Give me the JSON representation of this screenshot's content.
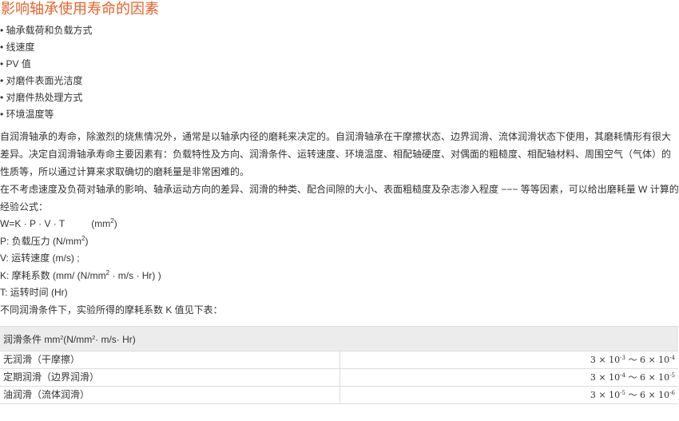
{
  "title": "影响轴承使用寿命的因素",
  "factors": [
    "轴承载荷和负载方式",
    "线速度",
    "PV 值",
    "对磨件表面光洁度",
    "对磨件热处理方式",
    "环境温度等"
  ],
  "paragraphs": [
    "自润滑轴承的寿命，除激烈的烧焦情况外，通常是以轴承内径的磨耗来决定的。自润滑轴承在干摩擦状态、边界润滑、流体润滑状态下使用，其磨耗情形有很大差异。决定自润滑轴承寿命主要因素有：负载特性及方向、润滑条件、运转速度、环境温度、相配轴硬度、对偶面的粗糙度、相配轴材料、周围空气（气体）的性质等，所以通过计算来求取确切的磨耗量是非常困难的。",
    "在不考虑速度及负荷对轴承的影响、轴承运动方向的差异、润滑的种类、配合间隙的大小、表面粗糙度及杂志渗入程度 −−− 等等因素，可以给出磨耗量 W 计算的经验公式："
  ],
  "formula": {
    "expr": "W=K · P · V · T",
    "unit_prefix": "(mm",
    "unit_exp": "2",
    "unit_suffix": ")"
  },
  "definitions": {
    "p_prefix": "P: 负载压力 (N/mm",
    "p_exp": "2",
    "p_suffix": ")",
    "v": "V: 运转速度 (m/s) ;",
    "k_prefix": "K: 摩耗系数 (mm/ (N/mm",
    "k_exp": "2",
    "k_suffix": " ·  m/s ·  Hr) )",
    "t": "T: 运转时间 (Hr)"
  },
  "table_intro": "不同润滑条件下，实验所得的摩耗系数 K 值见下表：",
  "table": {
    "header_prefix": "润滑条件 mm",
    "header_exp": "2",
    "header_mid": "(N/mm",
    "header_exp2": "2",
    "header_suffix": "· m/s· Hr)",
    "rows": [
      {
        "condition": "无润滑（干摩擦）",
        "lo_exp": "-3",
        "hi_exp": "-4"
      },
      {
        "condition": "定期润滑（边界润滑）",
        "lo_exp": "-4",
        "hi_exp": "-5"
      },
      {
        "condition": "油润滑（流体润滑）",
        "lo_exp": "-5",
        "hi_exp": "-6"
      }
    ],
    "lo_coef": "3 × 10",
    "hi_coef": "6 × 10",
    "tilde": " ～ "
  },
  "colors": {
    "title": "#e8622a",
    "text": "#333333",
    "table_header_bg": "#ececec",
    "border": "#dcdcdc"
  }
}
